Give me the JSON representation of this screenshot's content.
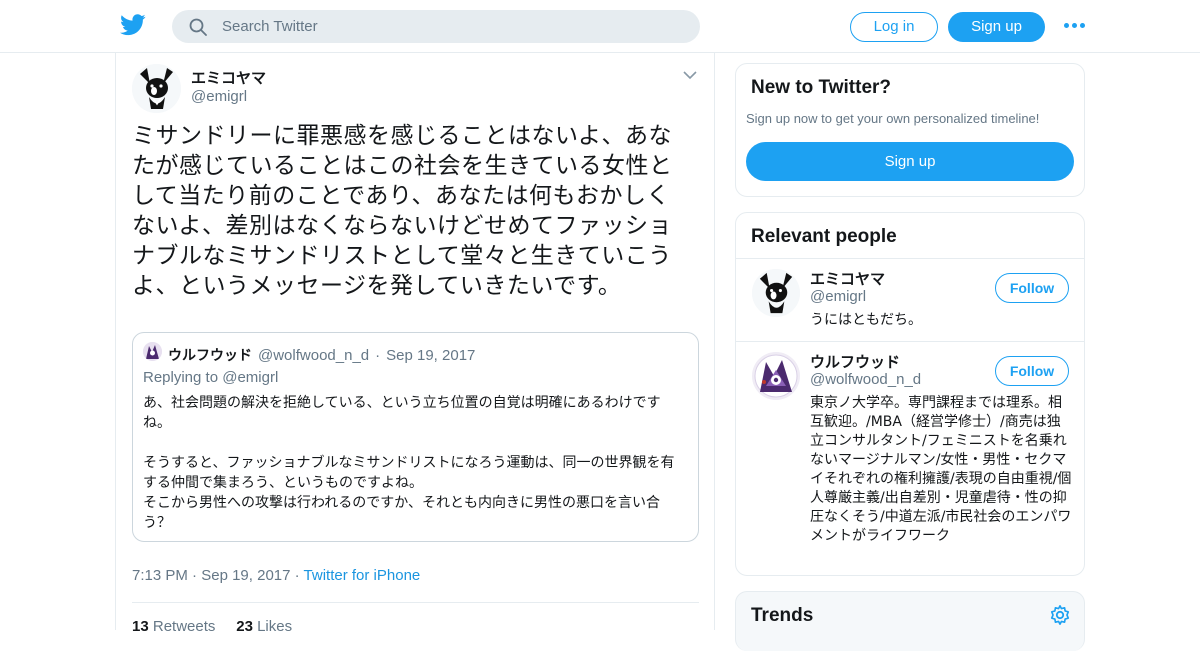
{
  "header": {
    "logo_icon": "twitter-bird-icon",
    "search": {
      "placeholder": "Search Twitter",
      "value": ""
    },
    "login_label": "Log in",
    "signup_label": "Sign up",
    "more_icon": "more-dots-icon"
  },
  "tweet": {
    "author_name": "エミコヤマ",
    "author_handle": "@emigrl",
    "text": "ミサンドリーに罪悪感を感じることはないよ、あなたが感じていることはこの社会を生きている女性として当たり前のことであり、あなたは何もおかしくないよ、差別はなくならないけどせめてファッショナブルなミサンドリストとして堂々と生きていこうよ、というメッセージを発していきたいです。",
    "quote": {
      "author_name": "ウルフウッド",
      "author_handle": "@wolfwood_n_d",
      "separator": "·",
      "date": "Sep 19, 2017",
      "replying_prefix": "Replying to",
      "replying_handle": "@emigrl",
      "text": "あ、社会問題の解決を拒絶している、という立ち位置の自覚は明確にあるわけですね。\n\nそうすると、ファッショナブルなミサンドリストになろう運動は、同一の世界観を有する仲間で集まろう、というものですよね。\nそこから男性への攻撃は行われるのですか、それとも内向きに男性の悪口を言い合う？"
    },
    "time": "7:13 PM",
    "separator": "·",
    "date": "Sep 19, 2017",
    "source": "Twitter for iPhone",
    "retweets_count": "13",
    "retweets_label": "Retweets",
    "likes_count": "23",
    "likes_label": "Likes"
  },
  "sidebar": {
    "new_to_twitter": {
      "title": "New to Twitter?",
      "subtitle": "Sign up now to get your own personalized timeline!",
      "signup_label": "Sign up"
    },
    "relevant_people": {
      "title": "Relevant people",
      "people": [
        {
          "name": "エミコヤマ",
          "handle": "@emigrl",
          "bio": "うにはともだち。",
          "follow_label": "Follow"
        },
        {
          "name": "ウルフウッド",
          "handle": "@wolfwood_n_d",
          "bio": "東京ノ大学卒。専門課程までは理系。相互歓迎。/MBA（経営学修士）/商売は独立コンサルタント/フェミニストを名乗れないマージナルマン/女性・男性・セクマイそれぞれの権利擁護/表現の自由重視/個人尊厳主義/出自差別・児童虐待・性の抑圧なくそう/中道左派/市民社会のエンパワメントがライフワーク",
          "follow_label": "Follow"
        }
      ]
    },
    "trends": {
      "title": "Trends",
      "settings_icon": "gear-icon"
    }
  },
  "colors": {
    "accent": "#1da1f2",
    "text": "#14171a",
    "secondary": "#657786",
    "border": "#e6ecf0"
  }
}
